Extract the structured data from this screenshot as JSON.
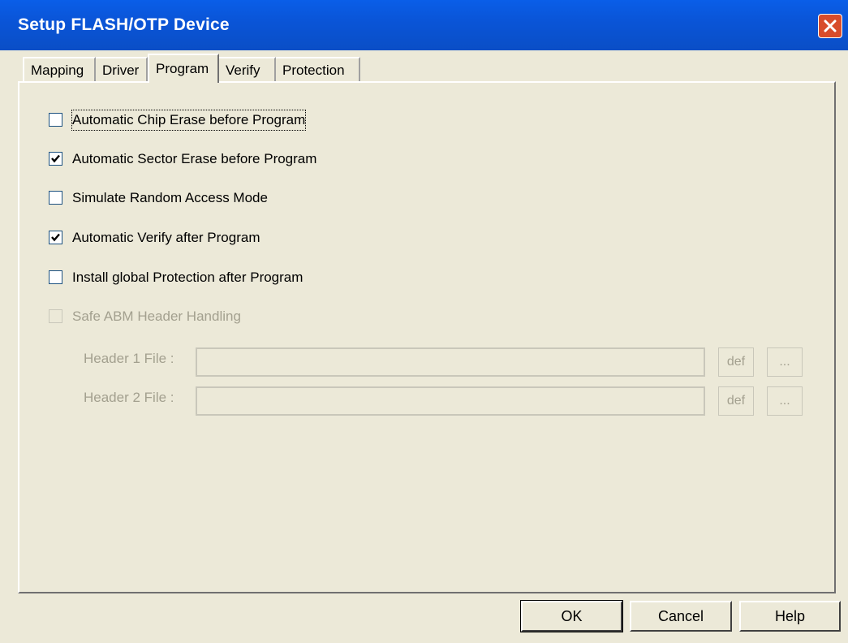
{
  "window": {
    "title": "Setup FLASH/OTP Device"
  },
  "tabs": [
    {
      "label": "Mapping"
    },
    {
      "label": "Driver"
    },
    {
      "label": "Program"
    },
    {
      "label": "Verify"
    },
    {
      "label": "Protection"
    }
  ],
  "active_tab": "Program",
  "options": [
    {
      "label": "Automatic Chip Erase before Program",
      "checked": false,
      "enabled": true
    },
    {
      "label": "Automatic Sector Erase before Program",
      "checked": true,
      "enabled": true
    },
    {
      "label": "Simulate Random Access Mode",
      "checked": false,
      "enabled": true
    },
    {
      "label": "Automatic Verify after Program",
      "checked": true,
      "enabled": true
    },
    {
      "label": "Install global Protection after Program",
      "checked": false,
      "enabled": true
    },
    {
      "label": "Safe ABM Header Handling",
      "checked": false,
      "enabled": false
    }
  ],
  "header_files": [
    {
      "label": "Header 1 File :",
      "value": "",
      "def_label": "def",
      "browse_label": "..."
    },
    {
      "label": "Header 2 File :",
      "value": "",
      "def_label": "def",
      "browse_label": "..."
    }
  ],
  "buttons": {
    "ok": "OK",
    "cancel": "Cancel",
    "help": "Help"
  },
  "icons": {
    "close": "close-icon",
    "check": "checkmark-icon"
  },
  "colors": {
    "titlebar": "#0a55d8",
    "dialog_bg": "#ece9d8",
    "close_button": "#d84c2b"
  }
}
